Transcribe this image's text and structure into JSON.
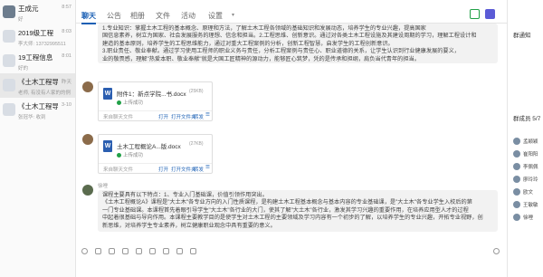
{
  "conversations": [
    {
      "name": "王成元",
      "preview": "好",
      "time": "8:57",
      "group": false
    },
    {
      "name": "2019级工程",
      "preview": "李大师: 13732995511",
      "time": "8:03",
      "group": true
    },
    {
      "name": "19工程信息",
      "preview": "好的",
      "time": "8:01",
      "group": true
    },
    {
      "name": "《土木工程导论》",
      "preview": "老师, 有没有人家的的例子",
      "time": "昨天",
      "group": true
    },
    {
      "name": "《土木工程导论》",
      "preview": "张冠华: 收到",
      "time": "3-10",
      "group": true
    }
  ],
  "tabs": [
    "聊天",
    "公告",
    "相册",
    "文件",
    "活动",
    "设置"
  ],
  "messages": {
    "top_text": [
      "1.专业知识：掌握土木工程的基本概念、原理和方法，了解土木工程各领域的基础知识和发展动态，培养学生的专业兴趣，提高国家",
      "国信息素养，树立为国家、社会发展服务的理想、信念和担当。2.工程思维、创新意识。通过对各类土木工程设施及其建设周期的学习，理解工程设计和",
      "建造的基本原则，培养学生的工程思维能力，通过对重大工程案例的分析，创新工程智慧，启发学生的工程创新意识。",
      "3.职业责任、敬业奉献。通过学习使用工程师的职业义务与责任，分析工程案例与责任心、职业道德的关系，让学生认识到行业健康发展的要义，",
      "业的敬畏感，理解\"热爱本职、敬业奉献\"就是大国工匠精神的源动力，能够匠心筑梦，凭的是传承和担纲，肩负当代青年的担当。"
    ],
    "files": [
      {
        "name": "附件1：新点学院...书.docx",
        "size": "(25KB)",
        "status": "上传成功",
        "source": "来自聊天文件",
        "open": "打开",
        "open_folder": "打开文件夹",
        "forward": "转发"
      },
      {
        "name": "土木工程概论A...版.docx",
        "size": "(27KB)",
        "status": "上传成功",
        "source": "来自聊天文件",
        "open": "打开",
        "open_folder": "打开文件夹",
        "forward": "转发"
      }
    ],
    "sender": "徐哩",
    "bottom_text": [
      "课程主要具有以下特点：1、专业入门基础课，价值引领作用突出。",
      "《土木工程概论A》课程是\"大土木\"各专业方向的入门性质课程，是构建土木工程基本概念与基本内容的专业基础课，是\"大土木\"各专业学生入校后的第",
      "一门专业基础课。本课程首先着眼引导学生\"大土木\"各行业的大门，使其了解\"大土木\"各行业，激发其学习兴趣的重要作用，在培养应用型人才的过程",
      "中起着很基础与导向作用。本课程主要教学目的是使学生对土木工程的主要领域及学习内容有一个初步的了解，以培养学生的专业兴趣，开拓专业视野，创",
      "新思维，对培养学生专业素养，树立健康职业观念中具有重要的意义。"
    ]
  },
  "right_panel": {
    "announce_title": "群通知",
    "members_title": "群成员 5/7",
    "members": [
      "孟颖颖",
      "崔阳阳",
      "李佩佩",
      "廖玲玲",
      "欧文",
      "王敏敏",
      "徐哩"
    ]
  },
  "colors": {
    "accent": "#1a5fb4",
    "success": "#21a047",
    "file_icon": "#2b5eb0"
  }
}
